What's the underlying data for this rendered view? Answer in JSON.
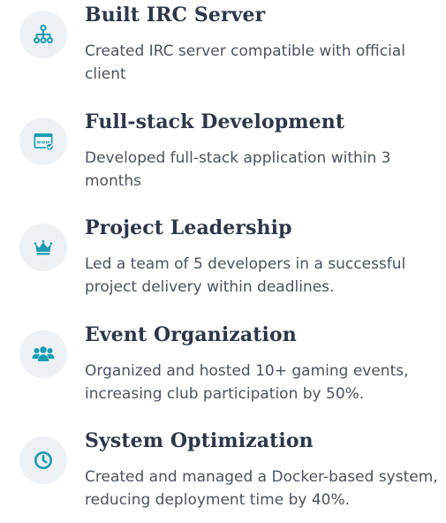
{
  "accent_color": "#1a9bb3",
  "items": [
    {
      "icon": "sitemap-icon",
      "title": "Built IRC Server",
      "description": "Created IRC server compatible with official client"
    },
    {
      "icon": "browser-window-icon",
      "title": "Full-stack Development",
      "description": "Developed full-stack application within 3 months"
    },
    {
      "icon": "crown-icon",
      "title": "Project Leadership",
      "description": "Led a team of 5 developers in a successful project delivery within deadlines."
    },
    {
      "icon": "users-icon",
      "title": "Event Organization",
      "description": "Organized and hosted 10+ gaming events, increasing club participation by 50%."
    },
    {
      "icon": "clock-icon",
      "title": "System Optimization",
      "description": "Created and managed a Docker-based system, reducing deployment time by 40%."
    }
  ]
}
